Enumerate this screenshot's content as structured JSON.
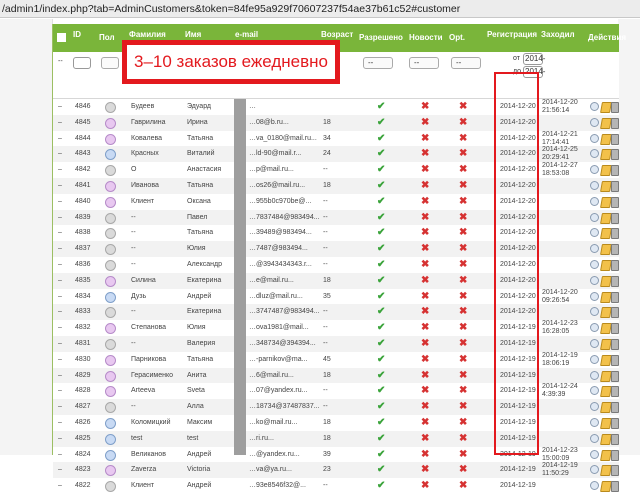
{
  "url": "/admin1/index.php?tab=AdminCustomers&token=84fe95a929f70607237f54ae37b61c52#customer",
  "banner": "3–10 заказов ежедневно",
  "header": {
    "id": "ID",
    "gender": "Пол",
    "lastname": "Фамилия",
    "firstname": "Имя",
    "email": "e-mail",
    "age": "Возраст",
    "allowed": "Разрешено",
    "news": "Новости",
    "opt": "Opt.",
    "registration": "Регистрация",
    "last_visit": "Заходил",
    "actions": "Действия"
  },
  "filters": {
    "dash": "--",
    "from_label": "от",
    "to_label": "до",
    "from_value": "2014-",
    "to_value": "2014-",
    "select_value": "--"
  },
  "rows": [
    {
      "id": "4846",
      "g": "u",
      "ln": "Будеев",
      "fn": "Эдуард",
      "em": "…",
      "age": "",
      "al": "y",
      "nw": "n",
      "op": "n",
      "reg": "2014-12-20",
      "lv": "2014-12-20 21:56:14"
    },
    {
      "id": "4845",
      "g": "f",
      "ln": "Гаврилина",
      "fn": "Ирина",
      "em": "…08@b.ru...",
      "age": "18",
      "al": "y",
      "nw": "n",
      "op": "n",
      "reg": "2014-12-20",
      "lv": ""
    },
    {
      "id": "4844",
      "g": "f",
      "ln": "Ковалева",
      "fn": "Татьяна",
      "em": "…va_0180@mail.ru...",
      "age": "34",
      "al": "y",
      "nw": "n",
      "op": "n",
      "reg": "2014-12-20",
      "lv": "2014-12-21 17:14:41"
    },
    {
      "id": "4843",
      "g": "m",
      "ln": "Красных",
      "fn": "Виталий",
      "em": "…ld-90@mail.r...",
      "age": "24",
      "al": "y",
      "nw": "n",
      "op": "n",
      "reg": "2014-12-20",
      "lv": "2014-12-25 20:29:41"
    },
    {
      "id": "4842",
      "g": "u",
      "ln": "О",
      "fn": "Анастасия",
      "em": "…p@mail.ru...",
      "age": "--",
      "al": "y",
      "nw": "n",
      "op": "n",
      "reg": "2014-12-20",
      "lv": "2014-12-27 18:53:08"
    },
    {
      "id": "4841",
      "g": "f",
      "ln": "Иванова",
      "fn": "Татьяна",
      "em": "…os26@mail.ru...",
      "age": "18",
      "al": "y",
      "nw": "n",
      "op": "n",
      "reg": "2014-12-20",
      "lv": ""
    },
    {
      "id": "4840",
      "g": "f",
      "ln": "Клиент",
      "fn": "Оксана",
      "em": "…955b0c970be@...",
      "age": "--",
      "al": "y",
      "nw": "n",
      "op": "n",
      "reg": "2014-12-20",
      "lv": ""
    },
    {
      "id": "4839",
      "g": "u",
      "ln": "--",
      "fn": "Павел",
      "em": "…7837484@983494...",
      "age": "--",
      "al": "y",
      "nw": "n",
      "op": "n",
      "reg": "2014-12-20",
      "lv": ""
    },
    {
      "id": "4838",
      "g": "u",
      "ln": "--",
      "fn": "Татьяна",
      "em": "…39489@983494...",
      "age": "--",
      "al": "y",
      "nw": "n",
      "op": "n",
      "reg": "2014-12-20",
      "lv": ""
    },
    {
      "id": "4837",
      "g": "u",
      "ln": "--",
      "fn": "Юлия",
      "em": "…7487@983494...",
      "age": "--",
      "al": "y",
      "nw": "n",
      "op": "n",
      "reg": "2014-12-20",
      "lv": ""
    },
    {
      "id": "4836",
      "g": "u",
      "ln": "--",
      "fn": "Александр",
      "em": "…@3943434343.r...",
      "age": "--",
      "al": "y",
      "nw": "n",
      "op": "n",
      "reg": "2014-12-20",
      "lv": ""
    },
    {
      "id": "4835",
      "g": "f",
      "ln": "Силина",
      "fn": "Екатерина",
      "em": "…e@mail.ru...",
      "age": "18",
      "al": "y",
      "nw": "n",
      "op": "n",
      "reg": "2014-12-20",
      "lv": ""
    },
    {
      "id": "4834",
      "g": "m",
      "ln": "Дузь",
      "fn": "Андрей",
      "em": "…dluz@mail.ru...",
      "age": "35",
      "al": "y",
      "nw": "n",
      "op": "n",
      "reg": "2014-12-20",
      "lv": "2014-12-20 09:26:54"
    },
    {
      "id": "4833",
      "g": "u",
      "ln": "--",
      "fn": "Екатерина",
      "em": "…3747487@983494...",
      "age": "--",
      "al": "y",
      "nw": "n",
      "op": "n",
      "reg": "2014-12-20",
      "lv": ""
    },
    {
      "id": "4832",
      "g": "f",
      "ln": "Степанова",
      "fn": "Юлия",
      "em": "…ova1981@mail...",
      "age": "--",
      "al": "y",
      "nw": "n",
      "op": "n",
      "reg": "2014-12-19",
      "lv": "2014-12-23 16:28:05"
    },
    {
      "id": "4831",
      "g": "u",
      "ln": "--",
      "fn": "Валерия",
      "em": "…348734@394394...",
      "age": "--",
      "al": "y",
      "nw": "n",
      "op": "n",
      "reg": "2014-12-19",
      "lv": ""
    },
    {
      "id": "4830",
      "g": "f",
      "ln": "Парникова",
      "fn": "Татьяна",
      "em": "…-parnikov@ma...",
      "age": "45",
      "al": "y",
      "nw": "n",
      "op": "n",
      "reg": "2014-12-19",
      "lv": "2014-12-19 18:06:19"
    },
    {
      "id": "4829",
      "g": "f",
      "ln": "Герасименко",
      "fn": "Анита",
      "em": "…6@mail.ru...",
      "age": "18",
      "al": "y",
      "nw": "n",
      "op": "n",
      "reg": "2014-12-19",
      "lv": ""
    },
    {
      "id": "4828",
      "g": "f",
      "ln": "Arteeva",
      "fn": "Sveta",
      "em": "…07@yandex.ru...",
      "age": "--",
      "al": "y",
      "nw": "n",
      "op": "n",
      "reg": "2014-12-19",
      "lv": "2014-12-24 4:39:39"
    },
    {
      "id": "4827",
      "g": "u",
      "ln": "--",
      "fn": "Алла",
      "em": "…18734@37487837...",
      "age": "--",
      "al": "y",
      "nw": "n",
      "op": "n",
      "reg": "2014-12-19",
      "lv": ""
    },
    {
      "id": "4826",
      "g": "m",
      "ln": "Коломицкий",
      "fn": "Максим",
      "em": "…ko@mail.ru...",
      "age": "18",
      "al": "y",
      "nw": "n",
      "op": "n",
      "reg": "2014-12-19",
      "lv": ""
    },
    {
      "id": "4825",
      "g": "m",
      "ln": "test",
      "fn": "test",
      "em": "…ri.ru...",
      "age": "18",
      "al": "y",
      "nw": "n",
      "op": "n",
      "reg": "2014-12-19",
      "lv": ""
    },
    {
      "id": "4824",
      "g": "m",
      "ln": "Великанов",
      "fn": "Андрей",
      "em": "…@yandex.ru...",
      "age": "39",
      "al": "y",
      "nw": "n",
      "op": "n",
      "reg": "2014-12-19",
      "lv": "2014-12-23 15:00:09"
    },
    {
      "id": "4823",
      "g": "f",
      "ln": "Zaverza",
      "fn": "Victoria",
      "em": "…va@ya.ru...",
      "age": "23",
      "al": "y",
      "nw": "n",
      "op": "n",
      "reg": "2014-12-19",
      "lv": "2014-12-19 11:50:29"
    },
    {
      "id": "4822",
      "g": "u",
      "ln": "Клиент",
      "fn": "Андрей",
      "em": "…93e8546f32@...",
      "age": "--",
      "al": "y",
      "nw": "n",
      "op": "n",
      "reg": "2014-12-19",
      "lv": ""
    }
  ]
}
